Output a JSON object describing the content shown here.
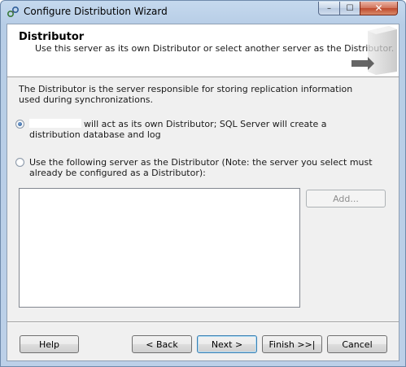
{
  "window": {
    "title": "Configure Distribution Wizard",
    "close_glyph": "✕",
    "min_glyph": "–",
    "max_glyph": "☐"
  },
  "header": {
    "title": "Distributor",
    "subtitle": "Use this server as its own Distributor or select another server as the Distributor.",
    "graphic_icon": "server-icon"
  },
  "description": "The Distributor is the server responsible for storing replication information used during synchronizations.",
  "options": {
    "own": {
      "label": "will act as its own Distributor; SQL Server will create a distribution database and log",
      "checked": true
    },
    "other": {
      "label": "Use the following server as the Distributor (Note: the server you select must already be configured as a Distributor):",
      "checked": false
    }
  },
  "buttons": {
    "add": "Add...",
    "help": "Help",
    "back": "< Back",
    "next": "Next >",
    "finish": "Finish >>|",
    "cancel": "Cancel"
  }
}
